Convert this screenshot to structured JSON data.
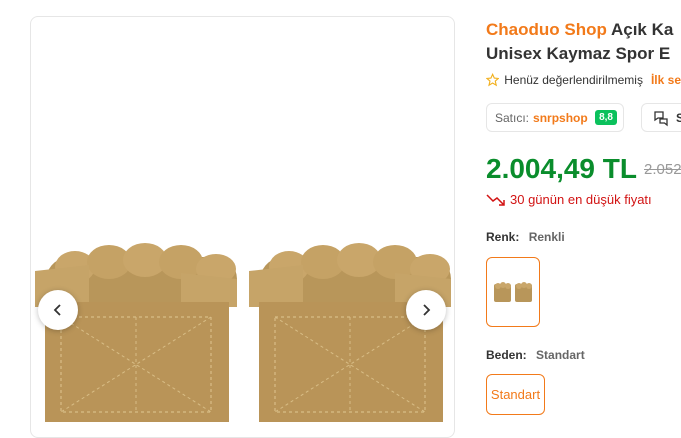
{
  "product": {
    "brand": "Chaoduo Shop",
    "title_line1": " Açık Ka",
    "title_line2": "Unisex Kaymaz Spor E"
  },
  "rating": {
    "text": "Henüz değerlendirilmemiş",
    "first_review": "İlk se"
  },
  "seller": {
    "label": "Satıcı:",
    "name": "snrpshop",
    "score": "8,8"
  },
  "ask_button": {
    "label": "S"
  },
  "pricing": {
    "price": "2.004,49 TL",
    "old_price": "2.052",
    "lowest_text": "30 günün en düşük fiyatı",
    "accent_color": "#0a8d2c"
  },
  "color": {
    "label": "Renk:",
    "value": "Renkli"
  },
  "size": {
    "label": "Beden:",
    "value": "Standart",
    "options": [
      "Standart"
    ]
  },
  "brand_color": "#f27a1a"
}
